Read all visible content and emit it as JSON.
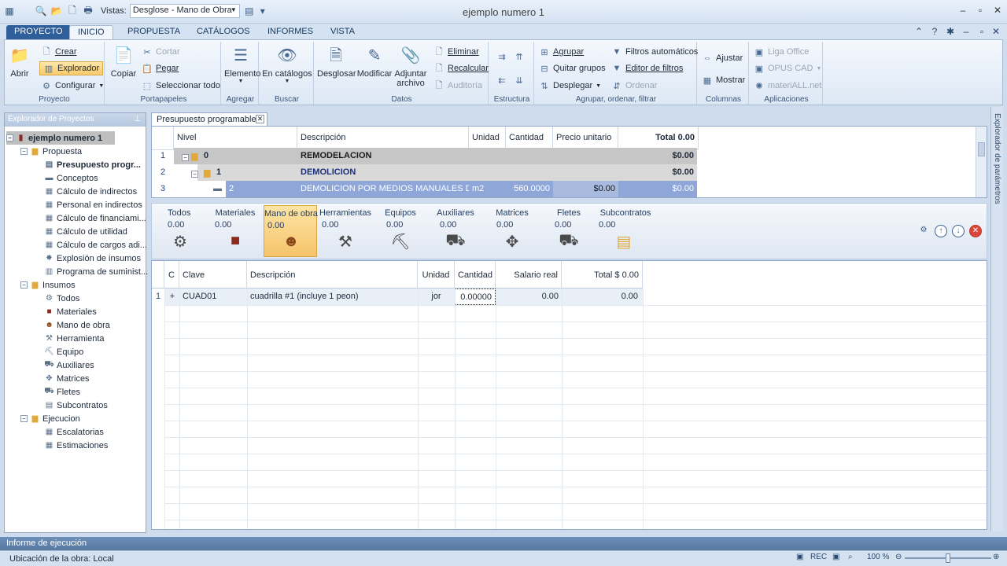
{
  "title_bar": {
    "vistas_label": "Vistas:",
    "vistas_value": "Desglose - Mano de Obra",
    "window_title": "ejemplo numero 1"
  },
  "ribbon_tabs": [
    "PROYECTO",
    "INICIO",
    "PROPUESTA",
    "CATÁLOGOS",
    "INFORMES",
    "VISTA"
  ],
  "ribbon": {
    "proyecto": {
      "label": "Proyecto",
      "abrir": "Abrir",
      "crear": "Crear",
      "explorador": "Explorador",
      "configurar": "Configurar"
    },
    "portapapeles": {
      "label": "Portapapeles",
      "copiar": "Copiar",
      "cortar": "Cortar",
      "pegar": "Pegar",
      "seleccionar_todo": "Seleccionar todo"
    },
    "agregar": {
      "label": "Agregar",
      "elemento": "Elemento"
    },
    "buscar": {
      "label": "Buscar",
      "en_catalogos": "En catálogos"
    },
    "datos": {
      "label": "Datos",
      "desglosar": "Desglosar",
      "modificar": "Modificar",
      "adjuntar": "Adjuntar",
      "archivo": "archivo",
      "eliminar": "Eliminar",
      "recalcular": "Recalcular",
      "auditoria": "Auditoría"
    },
    "estructura": {
      "label": "Estructura"
    },
    "agrupar_group": {
      "label": "Agrupar, ordenar, filtrar",
      "agrupar": "Agrupar",
      "quitar_grupos": "Quitar grupos",
      "desplegar": "Desplegar",
      "filtros": "Filtros automáticos",
      "editor": "Editor de filtros",
      "ordenar": "Ordenar"
    },
    "columnas": {
      "label": "Columnas",
      "ajustar": "Ajustar",
      "mostrar": "Mostrar"
    },
    "aplicaciones": {
      "label": "Aplicaciones",
      "liga_office": "Liga Office",
      "opus_cad": "OPUS CAD",
      "materiall": "materiALL.net"
    }
  },
  "left_panel": {
    "header": "Explorador de Proyectos",
    "root": "ejemplo numero 1",
    "propuesta": "Propuesta",
    "propuesta_items": [
      "Presupuesto progr...",
      "Conceptos",
      "Cálculo de indirectos",
      "Personal en indirectos",
      "Cálculo de financiami...",
      "Cálculo de utilidad",
      "Cálculo de cargos adi...",
      "Explosión de insumos",
      "Programa de suminist..."
    ],
    "insumos": "Insumos",
    "insumos_items": [
      "Todos",
      "Materiales",
      "Mano de obra",
      "Herramienta",
      "Equipo",
      "Auxiliares",
      "Matrices",
      "Fletes",
      "Subcontratos"
    ],
    "ejecucion": "Ejecucion",
    "ejecucion_items": [
      "Escalatorias",
      "Estimaciones"
    ]
  },
  "doc_tab": "Presupuesto programable",
  "upper_grid": {
    "headers": {
      "nivel": "Nivel",
      "descripcion": "Descripción",
      "unidad": "Unidad",
      "cantidad": "Cantidad",
      "precio": "Precio unitario",
      "total": "Total 0.00"
    },
    "rows": [
      {
        "n": "1",
        "nivel": "0",
        "descripcion": "REMODELACION",
        "unidad": "",
        "cantidad": "",
        "precio": "",
        "total": "$0.00"
      },
      {
        "n": "2",
        "nivel": "1",
        "descripcion": "DEMOLICION",
        "unidad": "",
        "cantidad": "",
        "precio": "",
        "total": "$0.00"
      },
      {
        "n": "3",
        "nivel": "2",
        "descripcion": "DEMOLICION POR MEDIOS MANUALES DE",
        "unidad": "m2",
        "cantidad": "560.0000",
        "precio": "$0.00",
        "total": "$0.00"
      }
    ]
  },
  "categories": [
    {
      "label": "Todos",
      "value": "0.00",
      "icon": "todos-icon"
    },
    {
      "label": "Materiales",
      "value": "0.00",
      "icon": "materiales-icon"
    },
    {
      "label": "Mano de obra",
      "value": "0.00",
      "icon": "mano-de-obra-icon"
    },
    {
      "label": "Herramientas",
      "value": "0.00",
      "icon": "herramientas-icon"
    },
    {
      "label": "Equipos",
      "value": "0.00",
      "icon": "equipos-icon"
    },
    {
      "label": "Auxiliares",
      "value": "0.00",
      "icon": "auxiliares-icon"
    },
    {
      "label": "Matrices",
      "value": "0.00",
      "icon": "matrices-icon"
    },
    {
      "label": "Fletes",
      "value": "0.00",
      "icon": "fletes-icon"
    },
    {
      "label": "Subcontratos",
      "value": "0.00",
      "icon": "subcontratos-icon"
    }
  ],
  "lower_grid": {
    "headers": {
      "c": "C",
      "clave": "Clave",
      "descripcion": "Descripción",
      "unidad": "Unidad",
      "cantidad": "Cantidad",
      "salario": "Salario real",
      "total": "Total $ 0.00"
    },
    "row": {
      "n": "1",
      "c": "+",
      "clave": "CUAD01",
      "descripcion": "cuadrilla #1 (incluye 1 peon)",
      "unidad": "jor",
      "cantidad": "0.00000",
      "salario": "0.00",
      "total": "0.00"
    }
  },
  "right_strip": "Explorador de parámetros",
  "informe": "Informe de ejecución",
  "status": {
    "ubicacion": "Ubicación de la obra: Local",
    "rec": "REC",
    "zoom": "100 %"
  },
  "colors": {
    "selected_row": "#8fa6d8",
    "selected_category": "#f6c46a",
    "accent": "#2f5f9b"
  }
}
